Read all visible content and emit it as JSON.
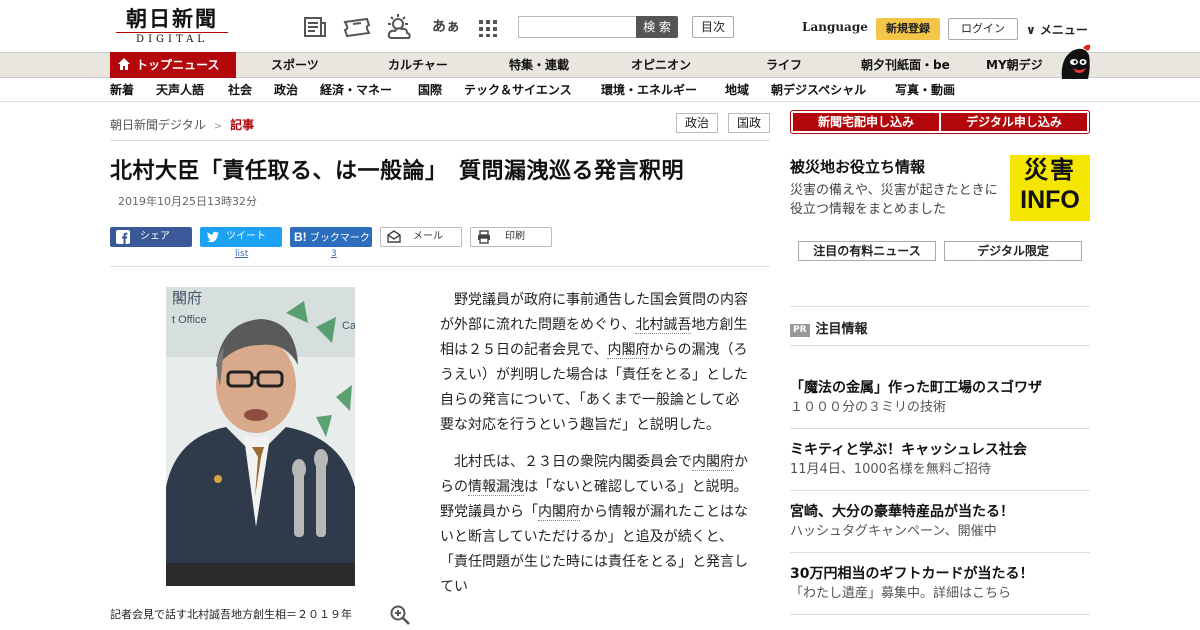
{
  "header": {
    "logo_main": "朝日新聞",
    "logo_sub": "DIGITAL",
    "search_button": "検 索",
    "index_button": "目次",
    "language": "Language",
    "register": "新規登録",
    "login": "ログイン",
    "menu": "∨ メニュー",
    "icons": [
      "newspaper-icon",
      "ticket-icon",
      "weather-icon",
      "font-size-icon",
      "grid-icon"
    ],
    "font_size_glyph": "あぁ"
  },
  "nav_primary": [
    {
      "label": "トップニュース",
      "active": true
    },
    {
      "label": "スポーツ"
    },
    {
      "label": "カルチャー"
    },
    {
      "label": "特集・連載"
    },
    {
      "label": "オピニオン"
    },
    {
      "label": "ライフ"
    },
    {
      "label": "朝夕刊紙面・be"
    },
    {
      "label": "MY朝デジ"
    }
  ],
  "nav_secondary": [
    "新着",
    "天声人語",
    "社会",
    "政治",
    "経済・マネー",
    "国際",
    "テック＆サイエンス",
    "環境・エネルギー",
    "地域",
    "朝デジスペシャル",
    "写真・動画"
  ],
  "breadcrumb": {
    "root": "朝日新聞デジタル",
    "separator": ">",
    "current": "記事"
  },
  "tags": [
    "政治",
    "国政"
  ],
  "article": {
    "title": "北村大臣「責任取る、は一般論」　質問漏洩巡る発言釈明",
    "date": "2019年10月25日13時32分",
    "share": {
      "facebook": "シェア",
      "twitter": "ツイート",
      "twitter_count": "list",
      "hatena": "ブックマーク",
      "hatena_count": "3",
      "mail": "メール",
      "print": "印刷"
    },
    "caption": "記者会見で話す北村誠吾地方創生相＝２０１９年",
    "paragraph1": [
      {
        "t": "野党議員が政府に事前通告した国会質問の内容が外部に流れた問題をめぐり、"
      },
      {
        "t": "北村誠吾",
        "kw": true
      },
      {
        "t": "地方創生相は２５日の記者会見で、"
      },
      {
        "t": "内閣府",
        "kw": true
      },
      {
        "t": "からの漏洩（ろうえい）が判明した場合は「責任をとる」とした自らの発言について、「あくまで一般論として必要な対応を行うという趣旨だ」と説明した。"
      }
    ],
    "paragraph2": [
      {
        "t": "北村氏は、２３日の衆院内閣委員会で"
      },
      {
        "t": "内閣府",
        "kw": true
      },
      {
        "t": "からの"
      },
      {
        "t": "情報漏洩",
        "kw": true
      },
      {
        "t": "は「ないと確認している」と説明。野党議員から「"
      },
      {
        "t": "内閣府",
        "kw": true
      },
      {
        "t": "から情報が漏れたことはないと断言していただけるか」と追及が続くと、「責任問題が生じた時には責任をとる」と発言してい"
      }
    ]
  },
  "sidebar": {
    "apply_newspaper": "新聞宅配申し込み",
    "apply_digital": "デジタル申し込み",
    "disaster_title": "被災地お役立ち情報",
    "disaster_text": "災害の備えや、災害が起きたときに役立つ情報をまとめました",
    "badge_line1": "災害",
    "badge_line2": "INFO",
    "paid_news": "注目の有料ニュース",
    "digital_only": "デジタル限定",
    "pr_badge": "PR",
    "pr_label": "注目情報",
    "pr_items": [
      {
        "title": "「魔法の金属」作った町工場のスゴワザ",
        "sub": "１０００分の３ミリの技術"
      },
      {
        "title": "ミキティと学ぶ！キャッシュレス社会",
        "sub": "11月4日、1000名様を無料ご招待"
      },
      {
        "title": "宮崎、大分の豪華特産品が当たる！",
        "sub": "ハッシュタグキャンペーン、開催中"
      },
      {
        "title": "30万円相当のギフトカードが当たる！",
        "sub": "「わたし遺産」募集中。詳細はこちら"
      }
    ]
  },
  "colors": {
    "brand_red": "#b4070b",
    "register_yellow": "#f3c64a",
    "facebook": "#3b5998",
    "twitter": "#1da1f2",
    "hatena": "#2c6ebd",
    "info_yellow": "#f4e600"
  }
}
